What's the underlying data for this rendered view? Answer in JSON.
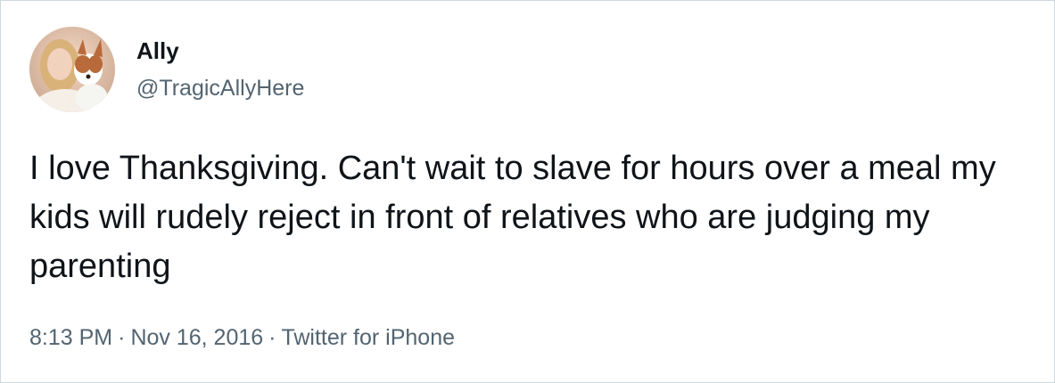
{
  "tweet": {
    "author": {
      "display_name": "Ally",
      "handle": "@TragicAllyHere"
    },
    "text": "I love Thanksgiving. Can't wait to slave for hours over a meal my kids will rudely reject in front of relatives who are judging my parenting",
    "meta": {
      "time": "8:13 PM",
      "separator": "·",
      "date": "Nov 16, 2016",
      "source": "Twitter for iPhone"
    }
  },
  "colors": {
    "text_primary": "#0f1419",
    "text_secondary": "#536471",
    "border": "#cfd9de"
  },
  "icons": {
    "avatar": "profile-photo-woman-with-dog"
  }
}
